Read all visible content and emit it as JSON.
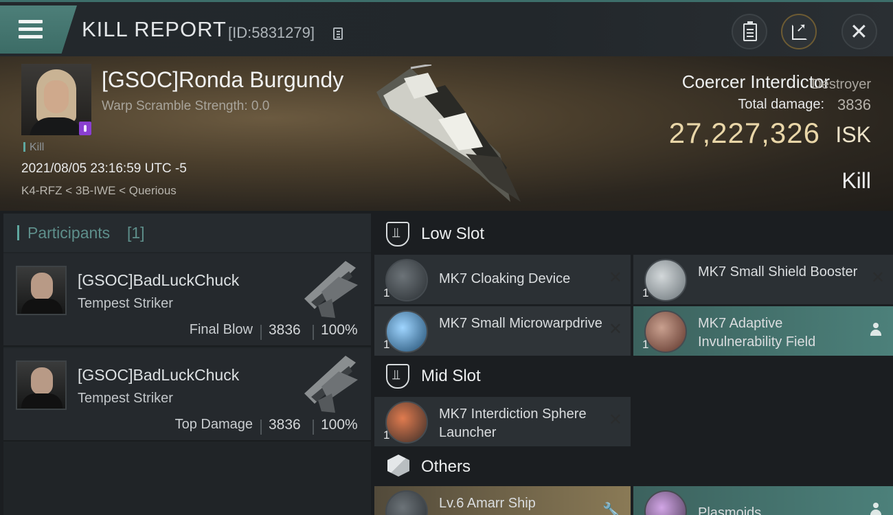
{
  "header": {
    "title": "KILL REPORT",
    "report_id": "[ID:5831279]"
  },
  "victim": {
    "name": "[GSOC]Ronda Burgundy",
    "warp_scramble": "Warp Scramble Strength: 0.0",
    "kill_tag": "Kill",
    "datetime": "2021/08/05 23:16:59 UTC -5",
    "location": "K4-RFZ < 3B-IWE < Querious",
    "ship_name": "Coercer Interdictor",
    "ship_class": "Destroyer",
    "total_damage_label": "Total damage:",
    "total_damage_value": "3836",
    "isk_value": "27,227,326",
    "isk_unit": "ISK",
    "result": "Kill"
  },
  "participants": {
    "title": "Participants",
    "count": "[1]",
    "rows": [
      {
        "name": "[GSOC]BadLuckChuck",
        "ship": "Tempest Striker",
        "label": "Final Blow",
        "damage": "3836",
        "percent": "100%"
      },
      {
        "name": "[GSOC]BadLuckChuck",
        "ship": "Tempest Striker",
        "label": "Top Damage",
        "damage": "3836",
        "percent": "100%"
      }
    ]
  },
  "slots": {
    "low_title": "Low Slot",
    "mid_title": "Mid Slot",
    "others_title": "Others",
    "items": [
      {
        "name": "MK7 Cloaking Device",
        "qty": "1",
        "icon": "cloaking-device-icon"
      },
      {
        "name": "MK7 Small Shield Booster",
        "qty": "1",
        "icon": "shield-booster-icon"
      },
      {
        "name": "MK7 Small Microwarpdrive",
        "qty": "1",
        "icon": "microwarpdrive-icon"
      },
      {
        "name": "MK7 Adaptive Invulnerability Field",
        "qty": "1",
        "icon": "invulnerability-field-icon"
      },
      {
        "name": "MK7 Interdiction Sphere Launcher",
        "qty": "1",
        "icon": "interdiction-launcher-icon"
      },
      {
        "name": "Lv.6 Amarr Ship",
        "qty": "",
        "icon": "amarr-ship-module-icon"
      },
      {
        "name": "Plasmoids",
        "qty": "",
        "icon": "plasmoids-icon"
      }
    ]
  },
  "colors": {
    "accent_teal": "#4c807a",
    "isk_gold": "#e9d6a8",
    "gold_item": "#8a7a56"
  }
}
